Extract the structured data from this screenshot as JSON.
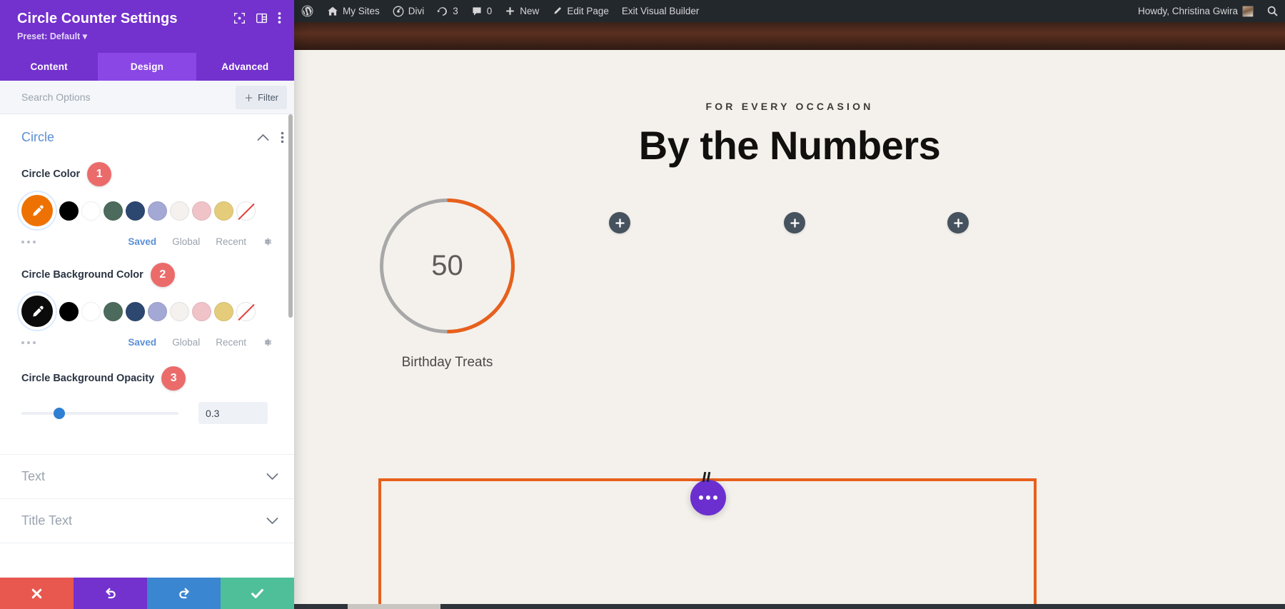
{
  "admin_bar": {
    "items": [
      {
        "id": "wp-logo",
        "icon": "wordpress-icon",
        "label": ""
      },
      {
        "id": "my-sites",
        "icon": "home-icon",
        "label": "My Sites"
      },
      {
        "id": "divi",
        "icon": "divi-icon",
        "label": "Divi"
      },
      {
        "id": "updates",
        "icon": "updates-icon",
        "label": "3"
      },
      {
        "id": "comments",
        "icon": "comment-icon",
        "label": "0"
      },
      {
        "id": "new",
        "icon": "plus-icon",
        "label": "New"
      },
      {
        "id": "edit-page",
        "icon": "pencil-icon",
        "label": "Edit Page"
      },
      {
        "id": "exit-visual-builder",
        "icon": "",
        "label": "Exit Visual Builder"
      }
    ],
    "account": {
      "greeting": "Howdy, Christina Gwira",
      "avatar": "user-avatar"
    },
    "search_icon": "search-icon",
    "background_color": "#23282d"
  },
  "settings_panel": {
    "title": "Circle Counter Settings",
    "preset_label": "Preset: Default",
    "header_icons": [
      "expand-icon",
      "layout-icon",
      "kebab-menu-icon"
    ],
    "accent_color": "#7331cd",
    "tabs": [
      {
        "label": "Content",
        "active": false
      },
      {
        "label": "Design",
        "active": true
      },
      {
        "label": "Advanced",
        "active": false
      }
    ],
    "search": {
      "placeholder": "Search Options",
      "value": ""
    },
    "filter_button": {
      "label": "Filter",
      "icon": "plus-icon"
    },
    "sections": {
      "circle": {
        "title": "Circle",
        "expanded": true,
        "fields": {
          "circle_color": {
            "label": "Circle Color",
            "badge": "1",
            "selected_color": "#ee7203",
            "selected_icon": "eyedropper-icon",
            "palette": [
              "#000000",
              "#ffffff",
              "#4d6b5d",
              "#2d4870",
              "#a4a8d4",
              "#f4f1ee",
              "#f0c3c8",
              "#e4cc7a"
            ],
            "none_swatch": "no-color-icon"
          },
          "circle_color_tabs": {
            "more_icon": "more-dots-icon",
            "saved": "Saved",
            "global": "Global",
            "recent": "Recent",
            "gear": "gear-icon"
          },
          "circle_background_color": {
            "label": "Circle Background Color",
            "badge": "2",
            "selected_color": "#0b0b0b",
            "selected_icon": "eyedropper-icon",
            "palette": [
              "#000000",
              "#ffffff",
              "#4d6b5d",
              "#2d4870",
              "#a4a8d4",
              "#f4f1ee",
              "#f0c3c8",
              "#e4cc7a"
            ],
            "none_swatch": "no-color-icon"
          },
          "circle_background_color_tabs": {
            "more_icon": "more-dots-icon",
            "saved": "Saved",
            "global": "Global",
            "recent": "Recent",
            "gear": "gear-icon"
          },
          "circle_background_opacity": {
            "label": "Circle Background Opacity",
            "badge": "3",
            "value": "0.3",
            "slider_percent": 22
          }
        }
      },
      "text": {
        "title": "Text",
        "expanded": false
      },
      "title_text": {
        "title": "Title Text",
        "expanded": false
      }
    },
    "footer_buttons": [
      {
        "id": "cancel",
        "icon": "close-x-icon",
        "color": "#e8584f"
      },
      {
        "id": "undo",
        "icon": "undo-arrow-icon",
        "color": "#7331cd"
      },
      {
        "id": "redo",
        "icon": "redo-arrow-icon",
        "color": "#3b86d1"
      },
      {
        "id": "save",
        "icon": "checkmark-icon",
        "color": "#4fbf9a"
      }
    ]
  },
  "canvas": {
    "background_color": "#f4f1ec",
    "eyebrow": "FOR EVERY OCCASION",
    "headline": "By the Numbers",
    "counter": {
      "number": "50",
      "label": "Birthday Treats",
      "percent": 50,
      "arc_color": "#e8601c",
      "track_color": "#a8a8a8"
    },
    "add_buttons": [
      {
        "id": "add-module-2",
        "icon": "plus-icon"
      },
      {
        "id": "add-module-3",
        "icon": "plus-icon"
      },
      {
        "id": "add-module-4",
        "icon": "plus-icon"
      }
    ],
    "section_outline_color": "#e8601c",
    "fab": {
      "icon": "three-dots-icon",
      "color": "#6b2fd0"
    }
  }
}
